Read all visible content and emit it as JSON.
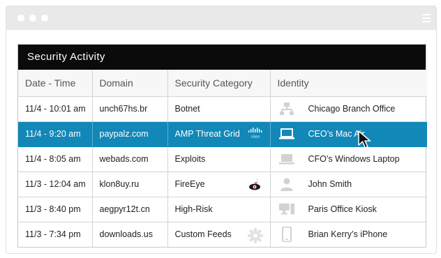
{
  "panel": {
    "title": "Security Activity"
  },
  "table": {
    "headers": [
      "Date - Time",
      "Domain",
      "Security Category",
      "Identity"
    ],
    "rows": [
      {
        "datetime": "11/4 - 10:01 am",
        "domain": "unch67hs.br",
        "category": "Botnet",
        "category_icon": "",
        "identity": "Chicago Branch Office",
        "identity_icon": "network-icon"
      },
      {
        "datetime": "11/4 - 9:20 am",
        "domain": "paypalz.com",
        "category": "AMP Threat Grid",
        "category_icon": "cisco-logo-icon",
        "identity": "CEO’s Mac Air",
        "identity_icon": "laptop-icon",
        "selected": true
      },
      {
        "datetime": "11/4 - 8:05 am",
        "domain": "webads.com",
        "category": "Exploits",
        "category_icon": "",
        "identity": "CFO’s Windows Laptop",
        "identity_icon": "laptop-icon"
      },
      {
        "datetime": "11/3 - 12:04 am",
        "domain": "klon8uy.ru",
        "category": "FireEye",
        "category_icon": "fireeye-logo-icon",
        "identity": "John Smith",
        "identity_icon": "user-icon"
      },
      {
        "datetime": "11/3 - 8:40 pm",
        "domain": "aegpyr12t.cn",
        "category": "High-Risk",
        "category_icon": "",
        "identity": "Paris Office Kiosk",
        "identity_icon": "kiosk-icon"
      },
      {
        "datetime": "11/3 - 7:34 pm",
        "domain": "downloads.us",
        "category": "Custom Feeds",
        "category_icon": "gear-icon",
        "identity": "Brian Kerry’s iPhone",
        "identity_icon": "phone-icon"
      }
    ]
  },
  "colors": {
    "header_bg": "#0b0b0b",
    "selected_row": "#1288b8",
    "titlebar": "#e9e9e9",
    "icon_gray": "#cfcfcf"
  }
}
